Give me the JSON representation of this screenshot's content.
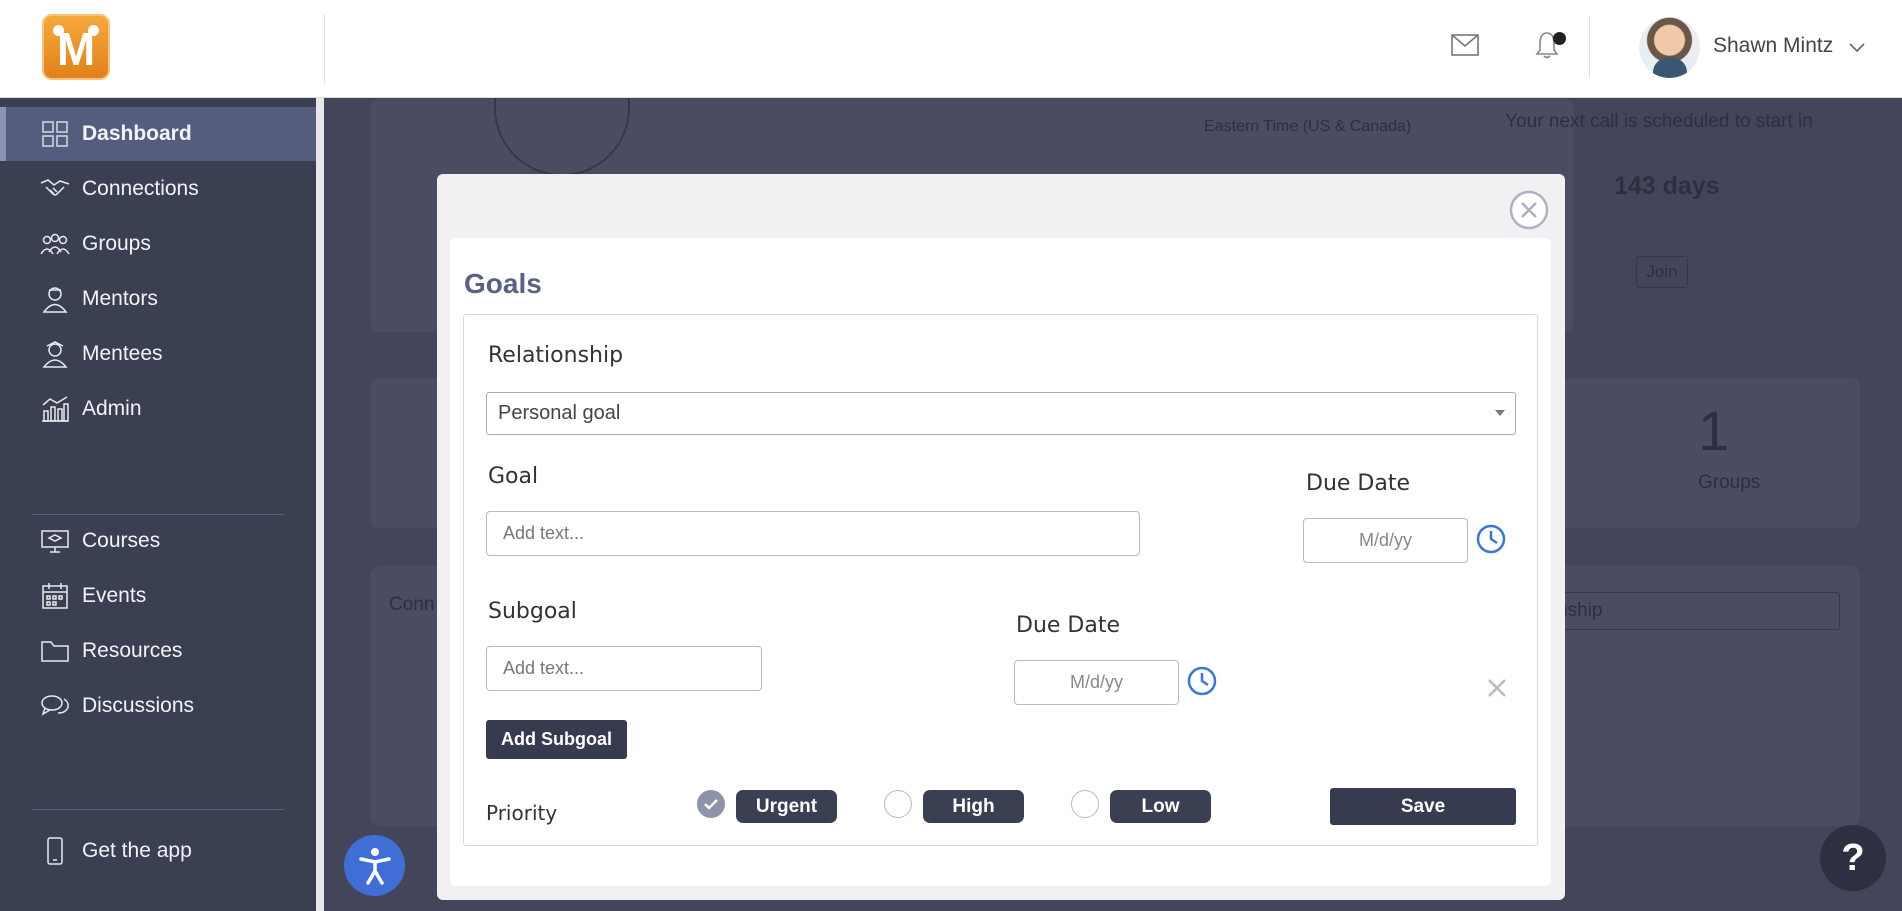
{
  "header": {
    "logo_letter": "M",
    "user_name": "Shawn Mintz",
    "icons": [
      "mail-icon",
      "bell-icon",
      "chevron-down-icon"
    ]
  },
  "sidebar": {
    "items": [
      {
        "label": "Dashboard",
        "icon": "dashboard-icon",
        "active": true
      },
      {
        "label": "Connections",
        "icon": "handshake-icon"
      },
      {
        "label": "Groups",
        "icon": "groups-icon"
      },
      {
        "label": "Mentors",
        "icon": "mentor-icon"
      },
      {
        "label": "Mentees",
        "icon": "mentee-icon"
      },
      {
        "label": "Admin",
        "icon": "admin-chart-icon"
      },
      {
        "label": "Courses",
        "icon": "courses-icon"
      },
      {
        "label": "Events",
        "icon": "calendar-icon"
      },
      {
        "label": "Resources",
        "icon": "folder-icon"
      },
      {
        "label": "Discussions",
        "icon": "chat-icon"
      }
    ],
    "get_app_label": "Get the app"
  },
  "background": {
    "timezone": "Eastern Time (US & Canada)",
    "next_call_text": "Your next call is scheduled to start in",
    "next_call_days": "143 days",
    "join_label": "Join",
    "groups_count": "1",
    "groups_label": "Groups",
    "connections_partial": "Conn",
    "relationship_partial": "nship"
  },
  "modal": {
    "title": "Goals",
    "relationship_label": "Relationship",
    "relationship_value": "Personal goal",
    "goal_label": "Goal",
    "goal_placeholder": "Add text...",
    "goal_due_label": "Due Date",
    "goal_due_placeholder": "M/d/yy",
    "subgoal_label": "Subgoal",
    "subgoal_placeholder": "Add text...",
    "subgoal_due_label": "Due Date",
    "subgoal_due_placeholder": "M/d/yy",
    "add_subgoal_label": "Add Subgoal",
    "priority_label": "Priority",
    "priorities": [
      {
        "label": "Urgent",
        "checked": true
      },
      {
        "label": "High",
        "checked": false
      },
      {
        "label": "Low",
        "checked": false
      }
    ],
    "save_label": "Save"
  },
  "help_label": "?"
}
